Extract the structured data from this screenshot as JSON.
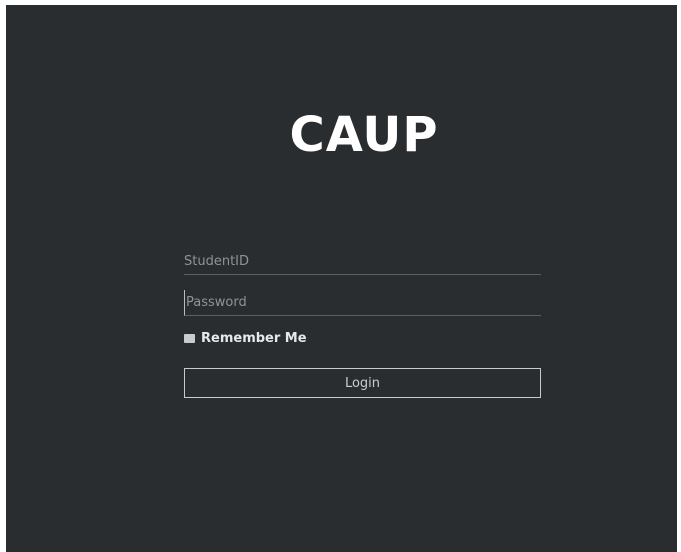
{
  "app": {
    "logo_text": "CAUP"
  },
  "login_form": {
    "student_id_placeholder": "StudentID",
    "student_id_value": "",
    "password_placeholder": "Password",
    "password_value": "",
    "remember_label": "Remember Me",
    "remember_checked": false,
    "login_label": "Login"
  },
  "colors": {
    "background": "#2a2d2f",
    "text": "#ffffff",
    "field_underline": "#5b5f62",
    "button_border": "#c8cbcd"
  }
}
